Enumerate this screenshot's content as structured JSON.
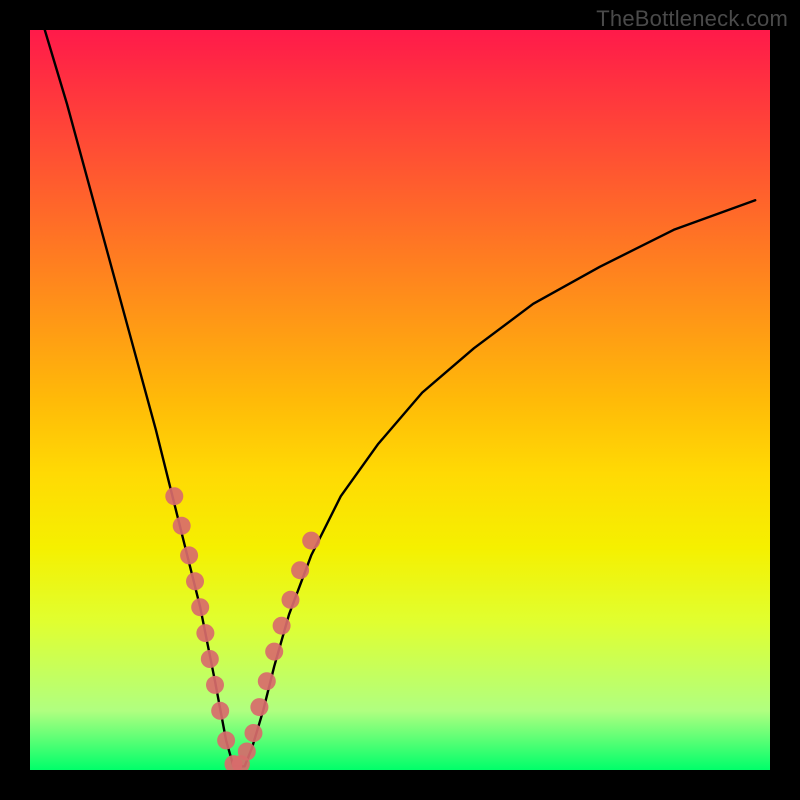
{
  "watermark": "TheBottleneck.com",
  "colors": {
    "curve": "#000000",
    "dot_fill": "#d86b6b",
    "dot_stroke": "#b94e4e"
  },
  "chart_data": {
    "type": "line",
    "title": "",
    "xlabel": "",
    "ylabel": "",
    "xlim": [
      0,
      100
    ],
    "ylim": [
      0,
      100
    ],
    "note": "V-shaped bottleneck curve with minimum near x≈27. Values are approximate (no axis labels in image).",
    "series": [
      {
        "name": "bottleneck-curve",
        "x": [
          2,
          5,
          8,
          11,
          14,
          17,
          19,
          21,
          23,
          25,
          26.5,
          27.5,
          29,
          30,
          31.5,
          33,
          35,
          38,
          42,
          47,
          53,
          60,
          68,
          77,
          87,
          98
        ],
        "y": [
          100,
          90,
          79,
          68,
          57,
          46,
          38,
          30,
          22,
          12,
          4,
          0.5,
          0.5,
          3,
          8,
          14,
          21,
          29,
          37,
          44,
          51,
          57,
          63,
          68,
          73,
          77
        ]
      }
    ],
    "marker_points": {
      "name": "highlight-dots",
      "x": [
        19.5,
        20.5,
        21.5,
        22.3,
        23.0,
        23.7,
        24.3,
        25.0,
        25.7,
        26.5,
        27.5,
        28.5,
        29.3,
        30.2,
        31.0,
        32.0,
        33.0,
        34.0,
        35.2,
        36.5,
        38.0
      ],
      "y": [
        37,
        33,
        29,
        25.5,
        22,
        18.5,
        15,
        11.5,
        8,
        4,
        0.8,
        0.8,
        2.5,
        5,
        8.5,
        12,
        16,
        19.5,
        23,
        27,
        31
      ]
    },
    "dot_radius_px": 9
  }
}
